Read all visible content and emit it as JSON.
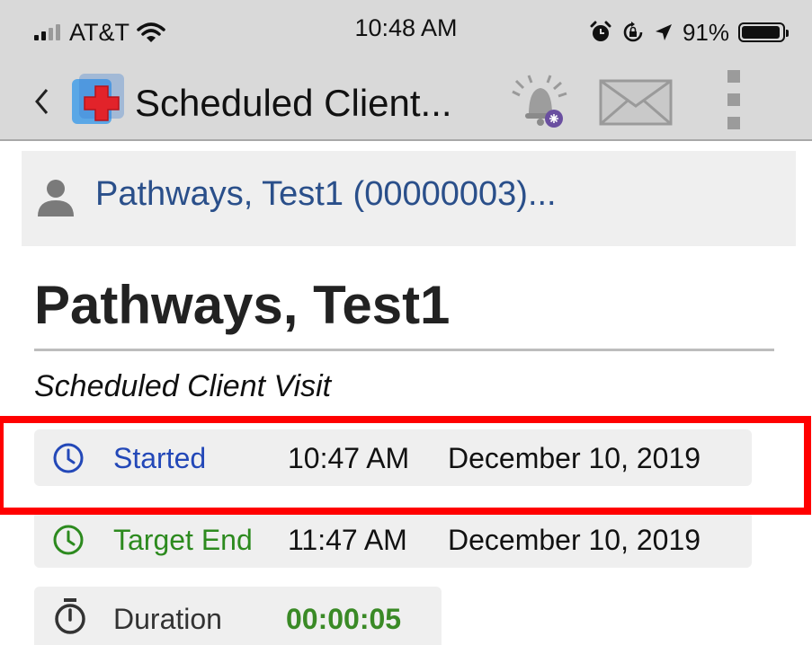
{
  "status_bar": {
    "carrier": "AT&T",
    "time": "10:48 AM",
    "battery": "91%",
    "signal_bars_filled": 2,
    "signal_bars_total": 4
  },
  "nav": {
    "title": "Scheduled Client...",
    "back_icon": "chevron-left-icon",
    "logo_icon": "medical-cross-logo-icon",
    "bell_icon": "bell-notification-icon",
    "mail_icon": "envelope-icon",
    "menu_icon": "kebab-menu-icon"
  },
  "client": {
    "link": "Pathways, Test1 (00000003)...",
    "icon": "person-icon"
  },
  "visit": {
    "name": "Pathways, Test1",
    "type": "Scheduled Client Visit",
    "started": {
      "label": "Started",
      "time": "10:47 AM",
      "date": "December 10, 2019",
      "icon": "clock-icon",
      "color": "#2348b8"
    },
    "target_end": {
      "label": "Target End",
      "time": "11:47 AM",
      "date": "December 10, 2019",
      "icon": "clock-icon",
      "color": "#2c8a1e"
    },
    "duration": {
      "label": "Duration",
      "value": "00:00:05",
      "icon": "stopwatch-icon",
      "color": "#3a8a26"
    }
  },
  "colors": {
    "highlight": "#ff0000",
    "link": "#2a4f8a",
    "bar_bg": "#d9d9d9"
  }
}
